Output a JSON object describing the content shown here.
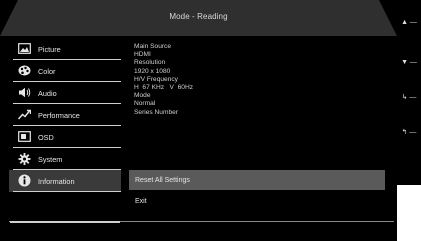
{
  "header": {
    "title": "Mode - Reading"
  },
  "sidebar": {
    "items": [
      {
        "label": "Picture",
        "icon": "picture-icon"
      },
      {
        "label": "Color",
        "icon": "color-palette-icon"
      },
      {
        "label": "Audio",
        "icon": "speaker-icon"
      },
      {
        "label": "Performance",
        "icon": "performance-chart-icon"
      },
      {
        "label": "OSD",
        "icon": "osd-icon"
      },
      {
        "label": "System",
        "icon": "gear-icon"
      },
      {
        "label": "Information",
        "icon": "info-icon"
      }
    ],
    "active_index": 6
  },
  "info": {
    "main_source_label": "Main Source",
    "main_source_value": "HDMI",
    "resolution_label": "Resolution",
    "resolution_value": "1920 x 1080",
    "hv_frequency_label": "H/V Frequency",
    "hv_frequency_value": "H  67 KHz   V  60Hz",
    "mode_label": "Mode",
    "mode_value": "Normal",
    "series_number_label": "Series Number"
  },
  "actions": {
    "reset_all_settings": "Reset All Settings",
    "exit": "Exit"
  },
  "keys": {
    "up": "▲ —",
    "down": "▼ —",
    "enter": "↳ —",
    "back": "↰ —"
  },
  "colors": {
    "background": "#000000",
    "title_bar": "#2f2f2f",
    "highlight": "#5a5a5a",
    "text": "#e6e6e6"
  }
}
